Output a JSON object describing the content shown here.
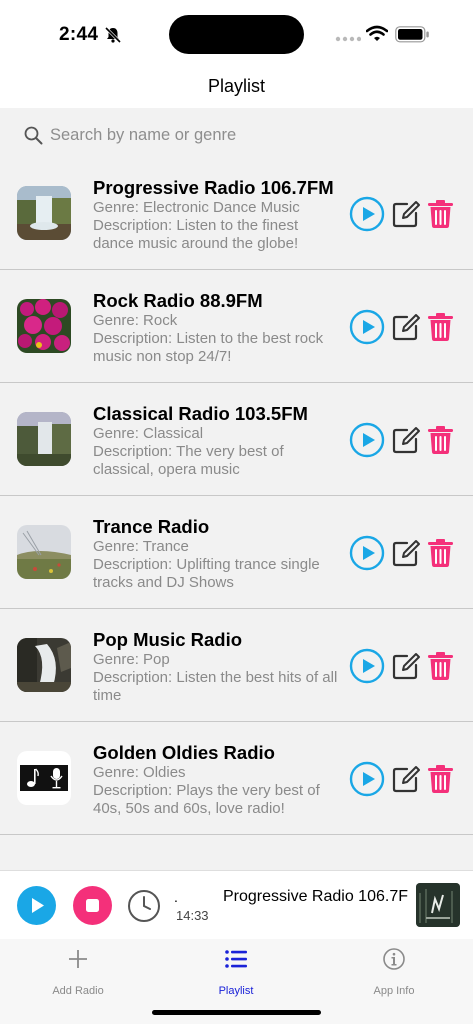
{
  "status": {
    "time": "2:44"
  },
  "nav": {
    "title": "Playlist"
  },
  "search": {
    "placeholder": "Search by name or genre",
    "value": ""
  },
  "stations": [
    {
      "name": "Progressive Radio 106.7FM",
      "genre": "Genre: Electronic Dance Music",
      "description": "Description: Listen to the finest dance music around the globe!"
    },
    {
      "name": "Rock Radio 88.9FM",
      "genre": "Genre: Rock",
      "description": "Description: Listen to the best rock music non stop 24/7!"
    },
    {
      "name": "Classical Radio 103.5FM",
      "genre": "Genre: Classical",
      "description": "Description: The very best of classical, opera music"
    },
    {
      "name": "Trance Radio",
      "genre": "Genre: Trance",
      "description": "Description: Uplifting trance single tracks and DJ Shows"
    },
    {
      "name": "Pop Music Radio",
      "genre": "Genre: Pop",
      "description": "Description: Listen the best hits of all time"
    },
    {
      "name": "Golden Oldies Radio",
      "genre": "Genre: Oldies",
      "description": "Description: Plays the very best of 40s, 50s and 60s, love radio!"
    }
  ],
  "player": {
    "dot": ".",
    "elapsed": "14:33",
    "now_playing": "Progressive Radio 106.7F"
  },
  "tabs": [
    {
      "label": "Add Radio",
      "icon": "plus-icon"
    },
    {
      "label": "Playlist",
      "icon": "list-icon"
    },
    {
      "label": "App Info",
      "icon": "info-icon"
    }
  ],
  "colors": {
    "play": "#1aa7e6",
    "stop": "#f4307a",
    "delete": "#f4307a",
    "active_tab": "#1a22d8",
    "background": "#f2f2f2"
  }
}
